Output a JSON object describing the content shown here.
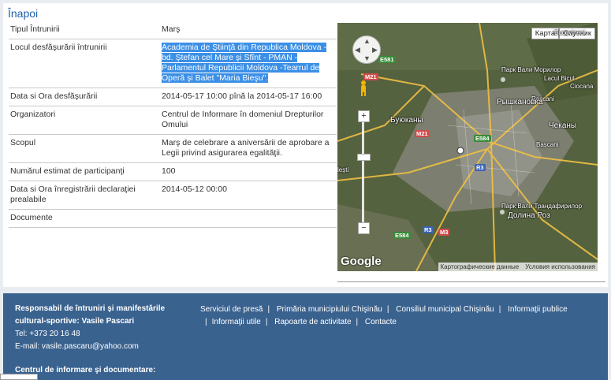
{
  "back_link": "Înapoi",
  "rows": [
    {
      "label": "Tipul Întrunirii",
      "value": "Marş"
    },
    {
      "label": "Locul desfăşurării întrunirii",
      "value": "Academia de Ştiinţă din Republica Moldova - bd. Ştefan cel Mare şi Sfînt - PMAN - Parlamentul Republicii Moldova -Tearrul de Operă şi Balet \"Maria Bieşu\"."
    },
    {
      "label": "Data si Ora desfăşurării",
      "value": "2014-05-17 10:00 pînă la 2014-05-17 16:00"
    },
    {
      "label": "Organizatori",
      "value": "Centrul de Informare în domeniul Drepturilor Omului"
    },
    {
      "label": "Scopul",
      "value": "Marş de celebrare a aniversării de aprobare a Legii privind asigurarea egalităţii."
    },
    {
      "label": "Numărul estimat de participanţi",
      "value": "100"
    },
    {
      "label": "Data si Ora înregistrării declaraţiei prealabile",
      "value": "2014-05-12 00:00"
    },
    {
      "label": "Documente",
      "value": ""
    }
  ],
  "map": {
    "type_buttons": [
      "Карта",
      "Спутник"
    ],
    "places": [
      "Рышкановка",
      "Буюканы",
      "Чеканы",
      "Долина Роз",
      "Парк Вали Морилор",
      "Парк Вали Трандафирилор",
      "Lacul Bicul",
      "Rascani",
      "Ciocana",
      "Bucovineni",
      "Bașcani",
      "lești"
    ],
    "roads": [
      "E581",
      "M21",
      "M21",
      "E584",
      "R3",
      "E584",
      "R3",
      "M3"
    ],
    "google": "Google",
    "attribution": [
      "Картографические данные",
      "Условия использования"
    ],
    "zoom_in": "+",
    "zoom_out": "−"
  },
  "footer": {
    "responsible_line1": "Responsabil de întruniri şi manifestările",
    "responsible_line2": "cultural-sportive: Vasile Pascari",
    "tel": "Tel: +373 20 16 48",
    "email": "E-mail: vasile.pascaru@yahoo.com",
    "links": [
      "Serviciul de presă",
      "Primăria municipiului Chişinău",
      "Consiliul municipal Chişinău",
      "Informaţii publice",
      "Informaţii utile",
      "Rapoarte de activitate",
      "Contacte"
    ],
    "center": "Centrul de informare şi documentare:"
  }
}
